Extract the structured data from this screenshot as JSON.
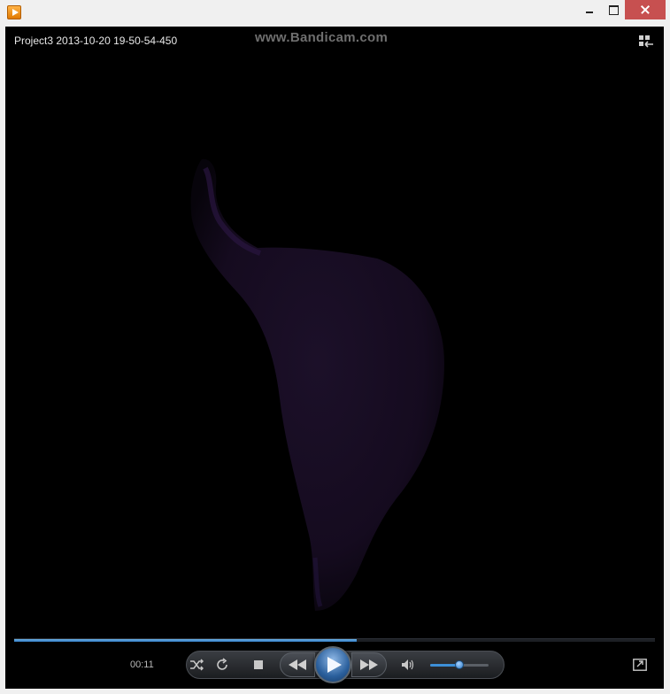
{
  "window": {
    "app_icon": "media-player-icon"
  },
  "player": {
    "video_title": "Project3 2013-10-20 19-50-54-450",
    "watermark": "www.Bandicam.com",
    "elapsed_time": "00:11",
    "seek_progress_percent": 53.5,
    "volume_percent": 50
  },
  "icons": {
    "switch": "switch-to-library-icon",
    "shuffle": "shuffle-icon",
    "repeat": "repeat-icon",
    "stop": "stop-icon",
    "previous": "previous-icon",
    "play": "play-icon",
    "next": "next-icon",
    "mute": "volume-icon",
    "fullscreen": "fullscreen-icon"
  },
  "colors": {
    "accent": "#3d8fd8",
    "close_button": "#c75050",
    "video_background": "#000000"
  }
}
